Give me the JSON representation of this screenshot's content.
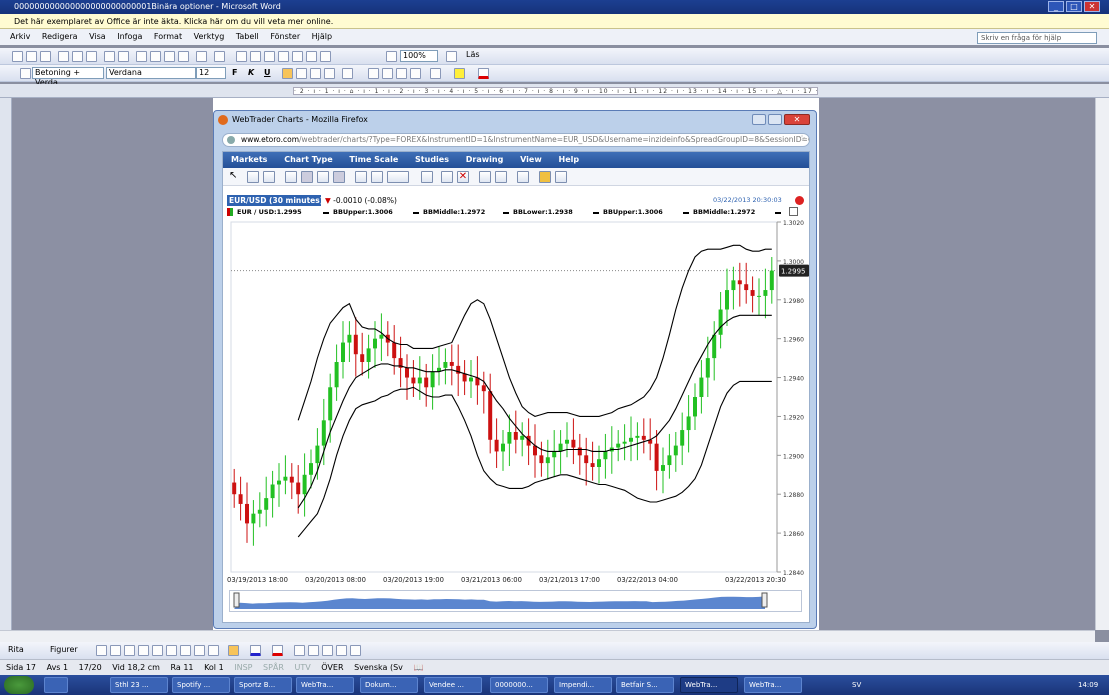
{
  "word": {
    "title": "000000000000000000000000001Binära optioner - Microsoft Word",
    "infobar": "Det här exemplaret av Office är inte äkta.  Klicka här om du vill veta mer online.",
    "menu": [
      "Arkiv",
      "Redigera",
      "Visa",
      "Infoga",
      "Format",
      "Verktyg",
      "Tabell",
      "Fönster",
      "Hjälp"
    ],
    "help_placeholder": "Skriv en fråga för hjälp",
    "zoom": "100%",
    "read_label": "Läs",
    "style": "Betoning + Verda",
    "font": "Verdana",
    "font_size": "12",
    "ruler_text": "· 2 · ı · 1 · ı · ⌂ · ı · 1 · ı · 2 · ı · 3 · ı · 4 · ı · 5 · ı · 6 · ı · 7 · ı · 8 · ı · 9 · ı · 10 · ı · 11 · ı · 12 · ı · 13 · ı · 14 · ı · 15 · ı · △ · ı · 17 · ı · 18 ·",
    "draw_label": "Rita",
    "shapes_label": "Figurer",
    "status": {
      "page": "Sida 17",
      "section": "Avs 1",
      "pages": "17/20",
      "position": "Vid 18,2 cm",
      "line": "Ra 11",
      "column": "Kol 1",
      "rec": "INSP",
      "track": "SPÅR",
      "ext": "UTV",
      "ovr": "ÖVER",
      "language": "Svenska (Sv"
    }
  },
  "taskbar": {
    "items": [
      "",
      "Sthl 23 ...",
      "Spotify ...",
      "Sportz B...",
      "WebTra...",
      "Dokum...",
      "Vendee ...",
      "0000000...",
      "Impendi...",
      "Betfair S...",
      "WebTra...",
      "WebTra..."
    ],
    "active_index": 10,
    "language": "SV",
    "clock": "14:09"
  },
  "firefox": {
    "title": "WebTrader Charts - Mozilla Firefox",
    "url_domain": "www.etoro.com",
    "url_path": "/webtrader/charts/?Type=FOREX&InstrumentID=1&InstrumentName=EUR_USD&Username=inzideinfo&SpreadGroupID=8&SessionID=C11AB"
  },
  "app": {
    "menu": [
      "Markets",
      "Chart Type",
      "Time Scale",
      "Studies",
      "Drawing",
      "View",
      "Help"
    ],
    "pair_label": "EUR/USD (30 minutes)",
    "change": "-0.0010 (-0.08%)",
    "timestamp": "03/22/2013 20:30:03",
    "legend": [
      "EUR / USD:1.2995",
      "BBUpper:1.3006",
      "BBMiddle:1.2972",
      "BBLower:1.2938",
      "BBUpper:1.3006",
      "BBMiddle:1.2972"
    ],
    "last_price": "1.2995"
  },
  "colors": {
    "up_candle": "#22c022",
    "down_candle": "#cc1111",
    "band_line": "#000000",
    "accent": "#2e62b0",
    "navigator_fill": "#5b86cf"
  },
  "chart_data": {
    "type": "candlestick",
    "y_ticks": [
      "1.3020",
      "1.3000",
      "1.2980",
      "1.2960",
      "1.2940",
      "1.2920",
      "1.2900",
      "1.2880",
      "1.2860",
      "1.2840"
    ],
    "ylim": [
      1.284,
      1.302
    ],
    "x_ticks": [
      "03/19/2013 18:00",
      "03/20/2013 08:00",
      "03/20/2013 19:00",
      "03/21/2013 06:00",
      "03/21/2013 17:00",
      "03/22/2013 04:00",
      "03/22/2013 20:30"
    ],
    "close": [
      1.288,
      1.2875,
      1.2865,
      1.287,
      1.2872,
      1.2878,
      1.2885,
      1.2887,
      1.2889,
      1.2886,
      1.288,
      1.289,
      1.2896,
      1.2905,
      1.2918,
      1.2935,
      1.2948,
      1.2958,
      1.2962,
      1.2952,
      1.2948,
      1.2955,
      1.296,
      1.2962,
      1.2958,
      1.295,
      1.2945,
      1.294,
      1.2937,
      1.294,
      1.2935,
      1.2943,
      1.2945,
      1.2948,
      1.2946,
      1.2942,
      1.2938,
      1.294,
      1.2936,
      1.2933,
      1.2908,
      1.2902,
      1.2906,
      1.2912,
      1.2908,
      1.291,
      1.2905,
      1.29,
      1.2896,
      1.2899,
      1.2902,
      1.2906,
      1.2908,
      1.2904,
      1.29,
      1.2896,
      1.2894,
      1.2898,
      1.2902,
      1.2904,
      1.2906,
      1.2907,
      1.2909,
      1.291,
      1.2908,
      1.2906,
      1.2892,
      1.2895,
      1.29,
      1.2905,
      1.2913,
      1.292,
      1.293,
      1.294,
      1.295,
      1.2962,
      1.2975,
      1.2985,
      1.299,
      1.2988,
      1.2985,
      1.2982,
      1.2982,
      1.2985,
      1.2995
    ],
    "bb_upper": [
      null,
      null,
      null,
      null,
      null,
      null,
      null,
      null,
      null,
      null,
      1.2918,
      1.2928,
      1.2938,
      1.295,
      1.296,
      1.2968,
      1.2972,
      1.2976,
      1.2978,
      1.297,
      1.2966,
      1.2965,
      1.2965,
      1.2963,
      1.296,
      1.2958,
      1.2957,
      1.2957,
      1.2955,
      1.2955,
      1.2955,
      1.2955,
      1.2956,
      1.2957,
      1.2958,
      1.2965,
      1.2972,
      1.2978,
      1.298,
      1.2978,
      1.297,
      1.296,
      1.295,
      1.294,
      1.2932,
      1.2925,
      1.2922,
      1.292,
      1.2921,
      1.2922,
      1.2922,
      1.2922,
      1.2922,
      1.2921,
      1.292,
      1.292,
      1.292,
      1.292,
      1.2921,
      1.2922,
      1.2924,
      1.2925,
      1.2926,
      1.2928,
      1.293,
      1.2934,
      1.294,
      1.295,
      1.2962,
      1.2975,
      1.2986,
      1.2995,
      1.3002,
      1.3005,
      1.3006,
      1.3006,
      1.3006,
      1.3007,
      1.3008,
      1.3008,
      1.3006,
      1.3005,
      1.3005,
      1.3006,
      1.3006
    ],
    "bb_middle": [
      null,
      null,
      null,
      null,
      null,
      null,
      null,
      null,
      null,
      null,
      1.2873,
      1.2878,
      1.2884,
      1.2892,
      1.2902,
      1.2912,
      1.292,
      1.2928,
      1.2935,
      1.294,
      1.2942,
      1.2944,
      1.2946,
      1.2947,
      1.2947,
      1.2946,
      1.2946,
      1.2945,
      1.2945,
      1.2944,
      1.2943,
      1.2943,
      1.2943,
      1.2944,
      1.2944,
      1.2943,
      1.2942,
      1.2941,
      1.294,
      1.2938,
      1.2933,
      1.2928,
      1.2924,
      1.2919,
      1.2915,
      1.2911,
      1.2908,
      1.2905,
      1.2903,
      1.2902,
      1.2902,
      1.2902,
      1.2903,
      1.2903,
      1.2903,
      1.2903,
      1.2902,
      1.2902,
      1.2902,
      1.2903,
      1.2903,
      1.2904,
      1.2905,
      1.2906,
      1.2907,
      1.2908,
      1.291,
      1.2914,
      1.2918,
      1.2924,
      1.2931,
      1.2938,
      1.2945,
      1.2951,
      1.2957,
      1.2962,
      1.2966,
      1.2969,
      1.2971,
      1.2972,
      1.2972,
      1.2972,
      1.2972,
      1.2972,
      1.2972
    ],
    "bb_lower": [
      null,
      null,
      null,
      null,
      null,
      null,
      null,
      null,
      null,
      null,
      1.2858,
      1.2862,
      1.2866,
      1.287,
      1.2878,
      1.2888,
      1.29,
      1.291,
      1.2918,
      1.2924,
      1.2926,
      1.2927,
      1.2928,
      1.293,
      1.2931,
      1.2933,
      1.2934,
      1.2934,
      1.2935,
      1.2933,
      1.2931,
      1.293,
      1.293,
      1.2931,
      1.2931,
      1.2925,
      1.2918,
      1.291,
      1.29,
      1.2892,
      1.2888,
      1.2885,
      1.2884,
      1.2883,
      1.2883,
      1.2883,
      1.2884,
      1.2886,
      1.2887,
      1.2888,
      1.2889,
      1.289,
      1.289,
      1.2889,
      1.2888,
      1.2887,
      1.2886,
      1.2885,
      1.2885,
      1.2884,
      1.2883,
      1.2882,
      1.288,
      1.2878,
      1.2877,
      1.2876,
      1.2876,
      1.2877,
      1.2878,
      1.2879,
      1.2881,
      1.2884,
      1.2888,
      1.2895,
      1.2905,
      1.2915,
      1.2925,
      1.2932,
      1.2936,
      1.2938,
      1.2938,
      1.2938,
      1.2938,
      1.2938,
      1.2938
    ],
    "last_value": 1.2995
  }
}
